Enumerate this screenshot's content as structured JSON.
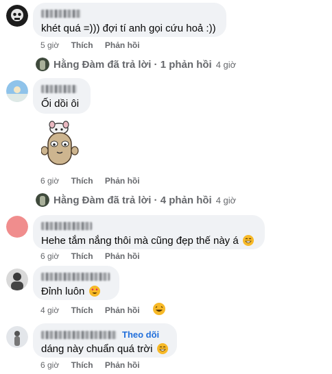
{
  "comments": [
    {
      "text": "khét quá =))) đợi tí anh gọi cứu hoả :))",
      "time": "5 giờ",
      "like": "Thích",
      "reply": "Phản hồi"
    },
    {
      "text": "Ối dồi ôi",
      "time": "6 giờ",
      "like": "Thích",
      "reply": "Phản hồi"
    },
    {
      "text": "Hehe tắm nắng thôi mà cũng đẹp thế này á",
      "time": "6 giờ",
      "like": "Thích",
      "reply": "Phản hồi"
    },
    {
      "text": "Đỉnh luôn",
      "time": "4 giờ",
      "like": "Thích",
      "reply": "Phản hồi"
    },
    {
      "follow": "Theo dõi",
      "text": "dáng này chuẩn quá trời",
      "time": "6 giờ",
      "like": "Thích",
      "reply": "Phản hồi"
    }
  ],
  "reply_summaries": [
    {
      "label": "Hằng Đàm đã trả lời · 1 phản hồi",
      "time": "4 giờ"
    },
    {
      "label": "Hằng Đàm đã trả lời · 4 phản hồi",
      "time": "4 giờ"
    }
  ],
  "colors": {
    "bubble": "#f0f2f5",
    "meta": "#65676b",
    "follow": "#216fdb",
    "emoji": "#f7b928"
  }
}
